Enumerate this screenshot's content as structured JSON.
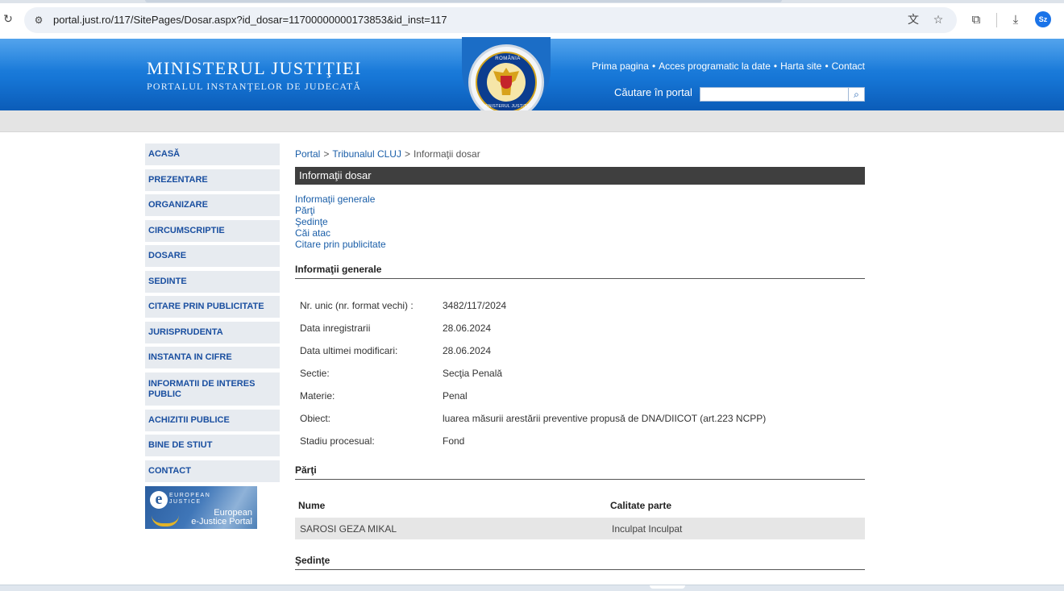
{
  "browser": {
    "url": "portal.just.ro/117/SitePages/Dosar.aspx?id_dosar=11700000000173853&id_inst=117",
    "profile_initials": "Sz"
  },
  "header": {
    "title": "MINISTERUL JUSTIŢIEI",
    "subtitle": "PORTALUL INSTANŢELOR DE JUDECATĂ",
    "logo_top": "ROMÂNIA",
    "logo_bottom": "MINISTERUL JUSTIŢIEI",
    "links": [
      "Prima pagina",
      "Acces programatic la date",
      "Harta site",
      "Contact"
    ],
    "search_label": "Căutare în portal",
    "search_value": ""
  },
  "sidebar": {
    "items": [
      "ACASĂ",
      "PREZENTARE",
      "ORGANIZARE",
      "CIRCUMSCRIPTIE",
      "DOSARE",
      "SEDINTE",
      "CITARE PRIN PUBLICITATE",
      "JURISPRUDENTA",
      "INSTANTA IN CIFRE",
      "INFORMATII DE INTERES PUBLIC",
      "ACHIZITII PUBLICE",
      "BINE DE STIUT",
      "CONTACT"
    ],
    "banner": {
      "small": [
        "EUROPEAN",
        "JUSTICE"
      ],
      "big": [
        "European",
        "e-Justice Portal"
      ]
    }
  },
  "breadcrumb": {
    "items": [
      "Portal",
      "Tribunalul CLUJ",
      "Informaţii dosar"
    ]
  },
  "main": {
    "title": "Informaţii dosar",
    "anchors": [
      "Informaţii generale",
      "Părţi",
      "Şedinţe",
      "Căi atac",
      "Citare prin publicitate"
    ],
    "general": {
      "heading": "Informaţii generale",
      "rows": [
        {
          "label": "Nr. unic (nr. format vechi) :",
          "value": "3482/117/2024"
        },
        {
          "label": "Data inregistrarii",
          "value": "28.06.2024"
        },
        {
          "label": "Data ultimei modificari:",
          "value": "28.06.2024"
        },
        {
          "label": "Sectie:",
          "value": "Secţia Penală"
        },
        {
          "label": "Materie:",
          "value": "Penal"
        },
        {
          "label": "Obiect:",
          "value": "luarea măsurii arestării preventive propusă de DNA/DIICOT (art.223 NCPP)"
        },
        {
          "label": "Stadiu procesual:",
          "value": "Fond"
        }
      ]
    },
    "parti": {
      "heading": "Părţi",
      "col_name": "Nume",
      "col_role": "Calitate parte",
      "rows": [
        {
          "name": "SAROSI GEZA MIKAL",
          "role": "Inculpat Inculpat"
        }
      ]
    },
    "sedinte": {
      "heading": "Şedinţe"
    }
  },
  "colors": {
    "header_blue": "#1676d6",
    "link_blue": "#1a5ea8",
    "nav_text": "#1a4fa0",
    "nav_bg": "#e7ebf0",
    "title_bar": "#3f3f3f"
  },
  "icons": {
    "reload": "reload-icon",
    "site_info": "site-info-icon",
    "translate": "translate-icon",
    "bookmark": "star-icon",
    "extensions": "puzzle-icon",
    "downloads": "download-icon",
    "search": "search-icon"
  }
}
